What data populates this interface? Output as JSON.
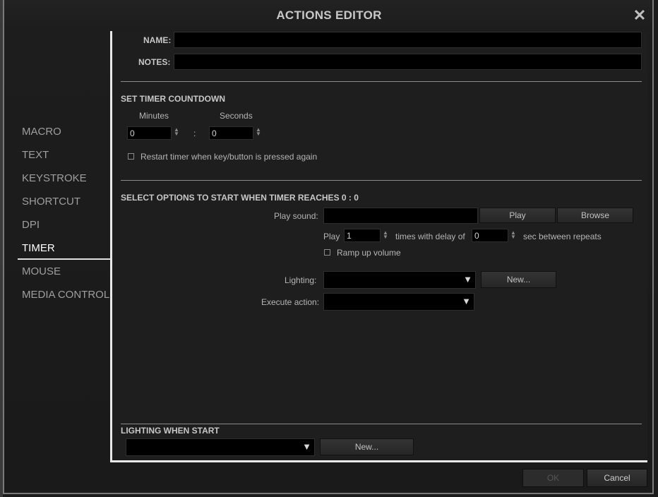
{
  "window": {
    "title": "ACTIONS EDITOR",
    "close_glyph": "✕"
  },
  "sidebar": {
    "items": [
      {
        "label": "MACRO",
        "active": false
      },
      {
        "label": "TEXT",
        "active": false
      },
      {
        "label": "KEYSTROKE",
        "active": false
      },
      {
        "label": "SHORTCUT",
        "active": false
      },
      {
        "label": "DPI",
        "active": false
      },
      {
        "label": "TIMER",
        "active": true
      },
      {
        "label": "MOUSE",
        "active": false
      },
      {
        "label": "MEDIA CONTROL",
        "active": false
      }
    ]
  },
  "form": {
    "name_label": "NAME:",
    "name_value": "",
    "notes_label": "NOTES:",
    "notes_value": ""
  },
  "countdown": {
    "heading": "SET TIMER COUNTDOWN",
    "minutes_label": "Minutes",
    "minutes_value": "0",
    "separator": ":",
    "seconds_label": "Seconds",
    "seconds_value": "0",
    "restart_label": "Restart timer when key/button is pressed again",
    "restart_checked": false
  },
  "options": {
    "heading": "SELECT OPTIONS TO START WHEN TIMER REACHES 0 : 0",
    "play_sound_label": "Play sound:",
    "play_sound_value": "",
    "play_button": "Play",
    "browse_button": "Browse",
    "play_prefix": "Play",
    "repeat_count": "1",
    "times_delay_label": "times with delay of",
    "delay_value": "0",
    "sec_between_label": "sec between repeats",
    "ramp_label": "Ramp up volume",
    "ramp_checked": false,
    "lighting_label": "Lighting:",
    "lighting_value": "",
    "lighting_new_button": "New...",
    "execute_label": "Execute action:",
    "execute_value": ""
  },
  "lighting_start": {
    "heading": "LIGHTING WHEN START",
    "value": "",
    "new_button": "New..."
  },
  "footer": {
    "ok": "OK",
    "cancel": "Cancel",
    "ok_enabled": false
  },
  "icons": {
    "dropdown": "dropdown-arrow-icon",
    "spinner": "spinner-arrows-icon",
    "close": "close-icon"
  },
  "colors": {
    "background": "#1a1a1a",
    "field": "#000000",
    "accent_border": "#e8e8e8"
  }
}
